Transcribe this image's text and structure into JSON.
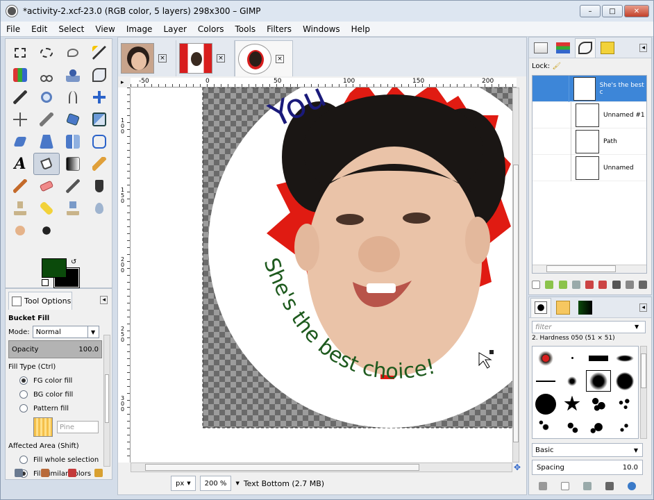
{
  "window": {
    "title": "*activity-2.xcf-23.0 (RGB color, 5 layers) 298x300 – GIMP",
    "minimize": "–",
    "maximize": "□",
    "close": "✕"
  },
  "menu": [
    "File",
    "Edit",
    "Select",
    "View",
    "Image",
    "Layer",
    "Colors",
    "Tools",
    "Filters",
    "Windows",
    "Help"
  ],
  "tool_options": {
    "tab_label": "Tool Options",
    "tool_name": "Bucket Fill",
    "mode_label": "Mode:",
    "mode_value": "Normal",
    "opacity_label": "Opacity",
    "opacity_value": "100.0",
    "fill_type_label": "Fill Type  (Ctrl)",
    "fill_options": [
      "FG color fill",
      "BG color fill",
      "Pattern fill"
    ],
    "pattern_name": "Pine",
    "affected_label": "Affected Area  (Shift)",
    "affected_options": [
      "Fill whole selection",
      "Fill similar colors"
    ]
  },
  "rulers": {
    "h_ticks": [
      "-50",
      "0",
      "50",
      "100",
      "150",
      "200"
    ],
    "v_ticks": [
      "1",
      "0",
      "0",
      "1",
      "5",
      "0",
      "2",
      "0",
      "0",
      "2",
      "5",
      "0",
      "3",
      "0",
      "0"
    ]
  },
  "canvas_text": {
    "arc_top": "You",
    "arc_bottom": "She's the best choice!"
  },
  "status": {
    "unit": "px",
    "zoom": "200 %",
    "message": "Text Bottom (2.7 MB)"
  },
  "paths_dock": {
    "lock_label": "Lock:",
    "paths": [
      "She's the best c",
      "Unnamed #1",
      "Path",
      "Unnamed"
    ]
  },
  "brushes_dock": {
    "filter_placeholder": "filter",
    "brush_info": "2. Hardness 050 (51 × 51)",
    "preset": "Basic",
    "spacing_label": "Spacing",
    "spacing_value": "10.0"
  },
  "colors": {
    "foreground": "#0b4a0b",
    "background": "#000000",
    "text_bottom": "#1e5a1e",
    "text_top": "#1a1a7a",
    "leaf_red": "#e01b12"
  }
}
